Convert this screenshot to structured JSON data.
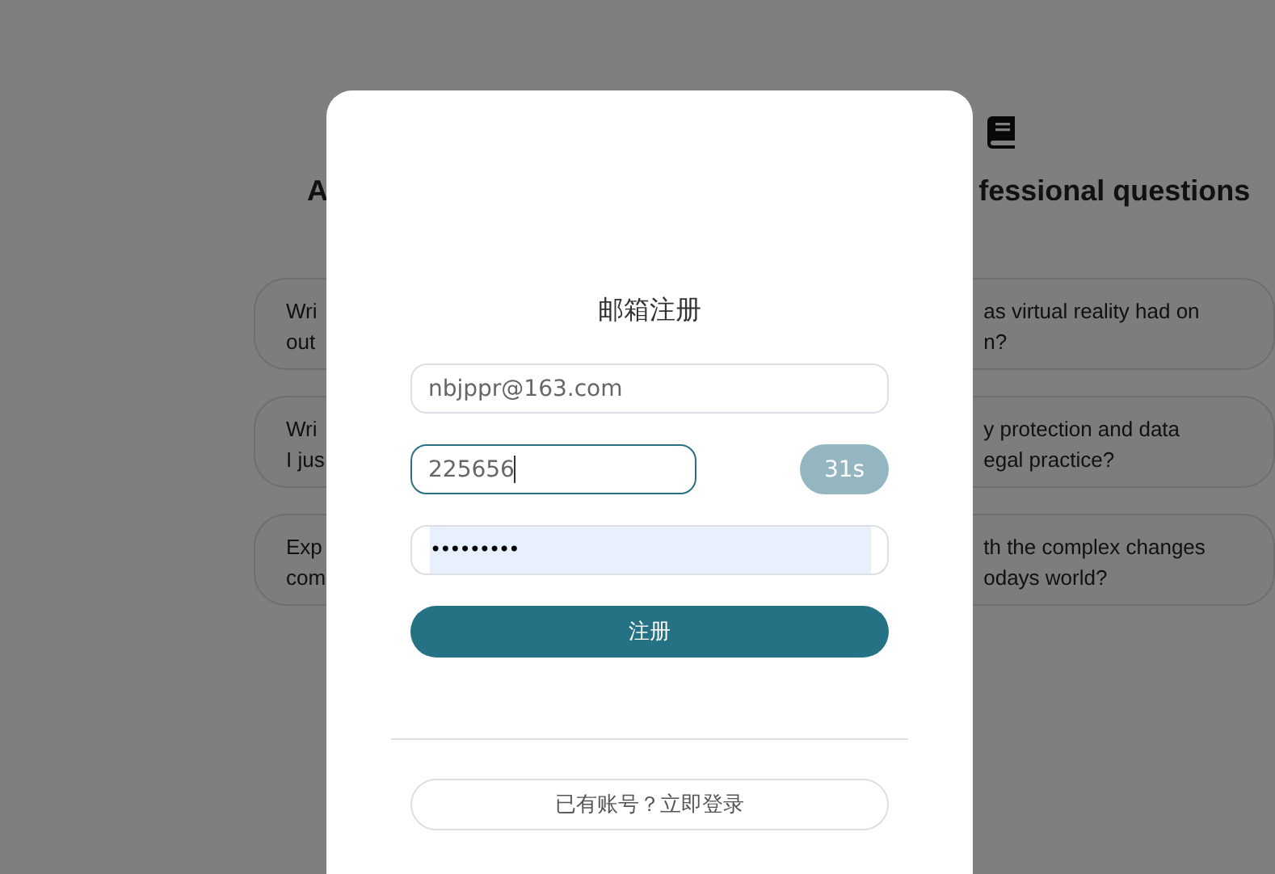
{
  "background": {
    "left_heading": "A",
    "right_heading": "fessional questions",
    "left_cards": [
      "Wri\nout",
      "Wri\nI jus",
      "Exp\ncom"
    ],
    "right_cards": [
      "as virtual reality had on\nn?",
      "y protection and data\negal practice?",
      "th the complex changes\nodays world?"
    ]
  },
  "dialog": {
    "title": "邮箱注册",
    "email": {
      "value": "nbjppr@163.com"
    },
    "code": {
      "value": "225656",
      "focused": true
    },
    "countdown": {
      "label": "31s",
      "disabled": true
    },
    "password": {
      "value": "•••••••••",
      "autofilled": true
    },
    "submit": "注册",
    "login": "已有账号？立即登录"
  }
}
